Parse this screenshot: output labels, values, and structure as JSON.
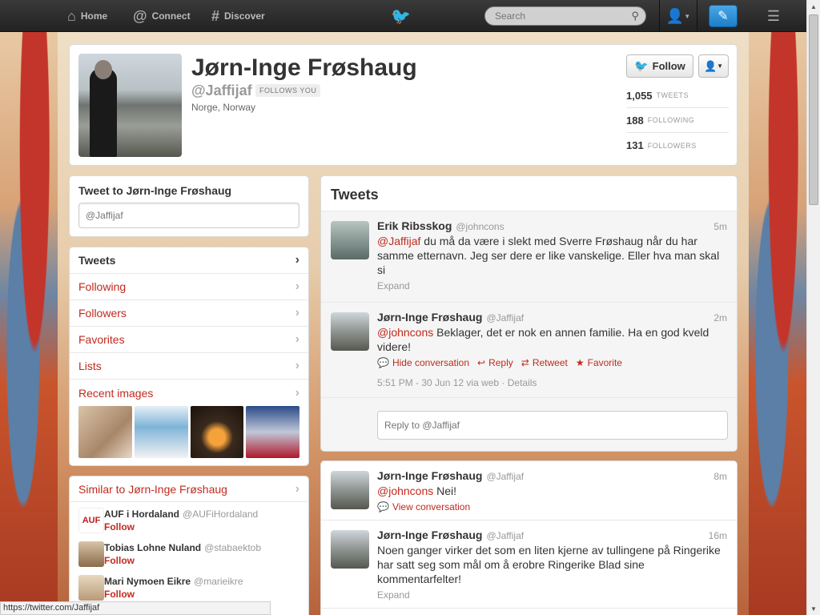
{
  "nav": {
    "home": "Home",
    "connect": "Connect",
    "discover": "Discover",
    "search_placeholder": "Search"
  },
  "profile": {
    "name": "Jørn-Inge Frøshaug",
    "handle": "@Jaffijaf",
    "follows_you": "FOLLOWS YOU",
    "location": "Norge, Norway",
    "follow_label": "Follow",
    "stats": [
      {
        "num": "1,055",
        "label": "TWEETS"
      },
      {
        "num": "188",
        "label": "FOLLOWING"
      },
      {
        "num": "131",
        "label": "FOLLOWERS"
      }
    ]
  },
  "tweet_to": {
    "title": "Tweet to Jørn-Inge Frøshaug",
    "placeholder": "@Jaffijaf"
  },
  "sidebar_nav": [
    {
      "label": "Tweets"
    },
    {
      "label": "Following"
    },
    {
      "label": "Followers"
    },
    {
      "label": "Favorites"
    },
    {
      "label": "Lists"
    },
    {
      "label": "Recent images"
    }
  ],
  "recent_images_colors": [
    "#c9a88a",
    "#7fb4d8",
    "#3a2a1e",
    "#b0c8e6"
  ],
  "similar": {
    "title": "Similar to Jørn-Inge Frøshaug",
    "users": [
      {
        "name": "AUF i Hordaland",
        "handle": "@AUFiHordaland",
        "follow": "Follow"
      },
      {
        "name": "Tobias Lohne Nuland",
        "handle": "@stabaektob",
        "follow": "Follow"
      },
      {
        "name": "Mari Nymoen Eikre",
        "handle": "@marieikre",
        "follow": "Follow"
      }
    ]
  },
  "tweets": {
    "title": "Tweets",
    "items": [
      {
        "name": "Erik Ribsskog",
        "handle": "@johncons",
        "time": "5m",
        "mention": "@Jaffijaf",
        "text": " du må da være i slekt med Sverre Frøshaug når du har samme etternavn. Jeg ser dere er like vanskelige. Eller hva man skal si",
        "expand": "Expand"
      },
      {
        "name": "Jørn-Inge Frøshaug",
        "handle": "@Jaffijaf",
        "time": "2m",
        "mention": "@johncons",
        "text": " Beklager, det er nok en annen familie. Ha en god kveld videre!",
        "actions": {
          "hide": "Hide conversation",
          "reply": "Reply",
          "retweet": "Retweet",
          "favorite": "Favorite"
        },
        "meta": "5:51 PM - 30 Jun 12 via web · Details"
      },
      {
        "name": "Jørn-Inge Frøshaug",
        "handle": "@Jaffijaf",
        "time": "8m",
        "mention": "@johncons",
        "text": " Nei!",
        "view": "View conversation"
      },
      {
        "name": "Jørn-Inge Frøshaug",
        "handle": "@Jaffijaf",
        "time": "16m",
        "text": "Noen ganger virker det som en liten kjerne av tullingene på Ringerike har satt seg som mål om å erobre Ringerike Blad sine kommentarfelter!",
        "expand": "Expand"
      }
    ],
    "reply_placeholder": "Reply to @Jaffijaf"
  },
  "statusbar": "https://twitter.com/Jaffijaf"
}
